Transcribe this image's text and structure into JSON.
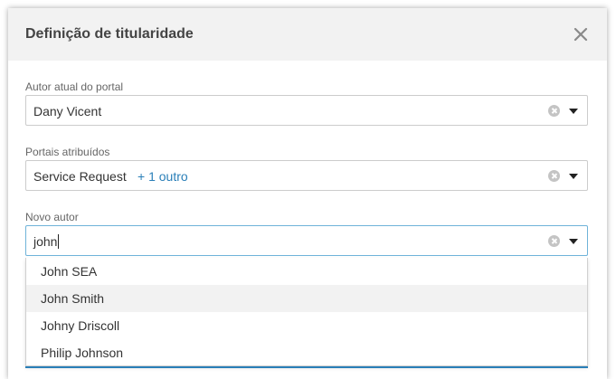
{
  "dialog": {
    "title": "Definição de titularidade"
  },
  "fields": {
    "current_author": {
      "label": "Autor atual do portal",
      "value": "Dany Vicent"
    },
    "assigned_portals": {
      "label": "Portais atribuídos",
      "value": "Service Request",
      "extra": "+ 1 outro"
    },
    "new_author": {
      "label": "Novo autor",
      "value": "john"
    }
  },
  "dropdown": {
    "options": [
      "John SEA",
      "John Smith",
      "Johny Driscoll",
      "Philip Johnson"
    ],
    "highlighted_index": 1
  },
  "colors": {
    "header_bg": "#f2f2f2",
    "accent": "#2a7fb8",
    "focus_border": "#6fb3d9"
  },
  "icons": {
    "close": "close-icon",
    "clear": "clear-icon",
    "caret": "chevron-down-icon"
  }
}
